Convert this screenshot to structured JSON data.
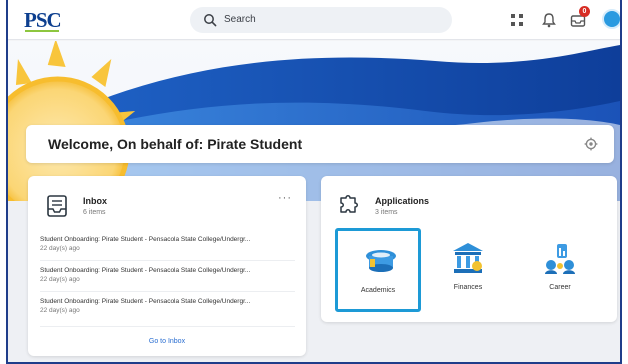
{
  "brand": {
    "logo_text": "PSC",
    "colors": {
      "navy": "#0d3f8f",
      "accent_green": "#8dc63f",
      "selected": "#1d9ad6",
      "notification": "#d72d24"
    }
  },
  "header": {
    "search_label": "Search",
    "icons": [
      "search-icon",
      "apps-grid-icon",
      "bell-icon",
      "inbox-tray-icon",
      "avatar"
    ],
    "inbox_badge": "0"
  },
  "welcome": {
    "title": "Welcome, On behalf of: Pirate Student"
  },
  "inbox": {
    "title": "Inbox",
    "count": "6 items",
    "more_label": "···",
    "tasks": [
      {
        "title": "Student Onboarding: Pirate Student - Pensacola State College/Undergr...",
        "age": "22 day(s) ago"
      },
      {
        "title": "Student Onboarding: Pirate Student - Pensacola State College/Undergr...",
        "age": "22 day(s) ago"
      },
      {
        "title": "Student Onboarding: Pirate Student - Pensacola State College/Undergr...",
        "age": "22 day(s) ago"
      }
    ],
    "go_to_label": "Go to Inbox"
  },
  "applications": {
    "title": "Applications",
    "count": "3 items",
    "tiles": [
      {
        "label": "Academics",
        "icon": "academics-icon",
        "selected": true
      },
      {
        "label": "Finances",
        "icon": "finances-icon",
        "selected": false
      },
      {
        "label": "Career",
        "icon": "career-icon",
        "selected": false
      }
    ]
  }
}
